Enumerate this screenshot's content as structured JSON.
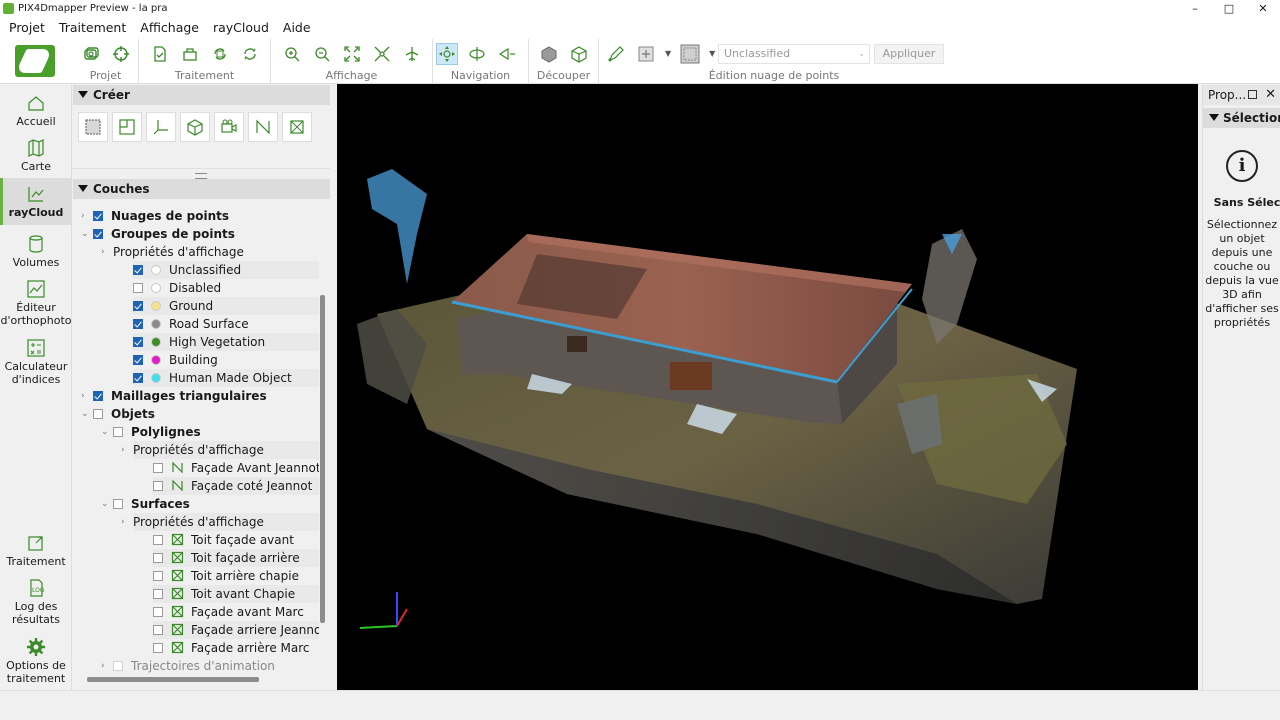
{
  "window": {
    "title": "PIX4Dmapper Preview - la pra",
    "controls": [
      "–",
      "□",
      "✕"
    ]
  },
  "menu": [
    "Projet",
    "Traitement",
    "Affichage",
    "rayCloud",
    "Aide"
  ],
  "toolbar": {
    "groups": [
      {
        "label": "Projet",
        "icons": [
          "project-images-icon",
          "gcp-manager-icon"
        ]
      },
      {
        "label": "Traitement",
        "icons": [
          "processing-options-icon",
          "open-processing-icon",
          "reprocess-icon",
          "reoptimize-icon"
        ]
      },
      {
        "label": "Affichage",
        "icons": [
          "zoom-in-icon",
          "zoom-out-icon",
          "zoom-all-icon",
          "zoom-selection-icon",
          "fly-to-icon"
        ]
      },
      {
        "label": "Navigation",
        "icons": [
          "trackball-icon",
          "first-person-icon",
          "perspective-icon"
        ]
      },
      {
        "label": "Découper",
        "icons": [
          "clip-box-icon",
          "edit-box-icon"
        ]
      },
      {
        "label": "Édition nuage de points",
        "icons": [
          "edit-densified-icon",
          "add-point-icon",
          "selection-shape-icon"
        ]
      }
    ],
    "class_select": "Unclassified",
    "apply_label": "Appliquer"
  },
  "nav": [
    {
      "label": "Accueil",
      "icon": "home-icon",
      "active": false
    },
    {
      "label": "Carte",
      "icon": "map-icon",
      "active": false
    },
    {
      "label": "rayCloud",
      "icon": "raycloud-icon",
      "active": true
    },
    {
      "label": "Volumes",
      "icon": "volumes-icon",
      "active": false
    },
    {
      "label": "Éditeur d'orthophoto",
      "icon": "ortho-editor-icon",
      "active": false
    },
    {
      "label": "Calculateur d'indices",
      "icon": "index-calculator-icon",
      "active": false
    },
    {
      "label": "Traitement",
      "icon": "processing-icon",
      "active": false
    },
    {
      "label": "Log des résultats",
      "icon": "log-icon",
      "active": false
    },
    {
      "label": "Options de traitement",
      "icon": "gear-icon",
      "active": false
    }
  ],
  "create": {
    "title": "Créer"
  },
  "layers": {
    "title": "Couches",
    "rows": [
      {
        "label": "Nuages de points",
        "level": 0,
        "bold": true,
        "checked": true,
        "expander": "›"
      },
      {
        "label": "Groupes de points",
        "level": 0,
        "bold": true,
        "checked": true,
        "expander": "⌄"
      },
      {
        "label": "Propriétés d'affichage",
        "level": 1,
        "expander": "›"
      },
      {
        "label": "Unclassified",
        "level": 2,
        "checked": true,
        "dot": "#ffffff",
        "shade": true
      },
      {
        "label": "Disabled",
        "level": 2,
        "checked": false,
        "dot": "#ffffff"
      },
      {
        "label": "Ground",
        "level": 2,
        "checked": true,
        "dot": "#f5e38a",
        "shade": true
      },
      {
        "label": "Road Surface",
        "level": 2,
        "checked": true,
        "dot": "#8a8a8a"
      },
      {
        "label": "High Vegetation",
        "level": 2,
        "checked": true,
        "dot": "#3c8f26",
        "shade": true
      },
      {
        "label": "Building",
        "level": 2,
        "checked": true,
        "dot": "#e01cc6"
      },
      {
        "label": "Human Made Object",
        "level": 2,
        "checked": true,
        "dot": "#3fe0ea",
        "shade": true
      },
      {
        "label": "Maillages triangulaires",
        "level": 0,
        "bold": true,
        "checked": true,
        "expander": "›"
      },
      {
        "label": "Objets",
        "level": 0,
        "bold": true,
        "checked": false,
        "expander": "⌄"
      },
      {
        "label": "Polylignes",
        "level": 1,
        "bold": true,
        "checked": false,
        "expander": "⌄"
      },
      {
        "label": "Propriétés d'affichage",
        "level": 2,
        "expander": "›",
        "shade": true
      },
      {
        "label": "Façade Avant Jeannot",
        "level": 3,
        "checked": false,
        "icon": "polyline-icon"
      },
      {
        "label": "Façade coté Jeannot",
        "level": 3,
        "checked": false,
        "icon": "polyline-icon",
        "shade": true
      },
      {
        "label": "Surfaces",
        "level": 1,
        "bold": true,
        "checked": false,
        "expander": "⌄"
      },
      {
        "label": "Propriétés d'affichage",
        "level": 2,
        "expander": "›",
        "shade": true
      },
      {
        "label": "Toit façade avant",
        "level": 3,
        "checked": false,
        "icon": "surface-icon"
      },
      {
        "label": "Toit façade arrière",
        "level": 3,
        "checked": false,
        "icon": "surface-icon",
        "shade": true
      },
      {
        "label": "Toit arrière chapie",
        "level": 3,
        "checked": false,
        "icon": "surface-icon"
      },
      {
        "label": "Toit avant Chapie",
        "level": 3,
        "checked": false,
        "icon": "surface-icon",
        "shade": true
      },
      {
        "label": "Façade avant Marc",
        "level": 3,
        "checked": false,
        "icon": "surface-icon"
      },
      {
        "label": "Façade arriere Jeannot",
        "level": 3,
        "checked": false,
        "icon": "surface-icon",
        "shade": true
      },
      {
        "label": "Façade arrière Marc",
        "level": 3,
        "checked": false,
        "icon": "surface-icon"
      },
      {
        "label": "Trajectoires d'animation",
        "level": 1,
        "bold": false,
        "checked": false,
        "expander": "›",
        "dim": true
      }
    ]
  },
  "properties": {
    "tab_label": "Prop...",
    "section": "Sélection",
    "empty_title": "Sans Sélec",
    "empty_desc": "Sélectionnez un objet depuis une couche ou depuis la vue 3D afin d'afficher ses propriétés"
  },
  "colors": {
    "accent": "#6cb33e",
    "checkbox": "#1f63b5",
    "viewport_bg": "#000000"
  }
}
